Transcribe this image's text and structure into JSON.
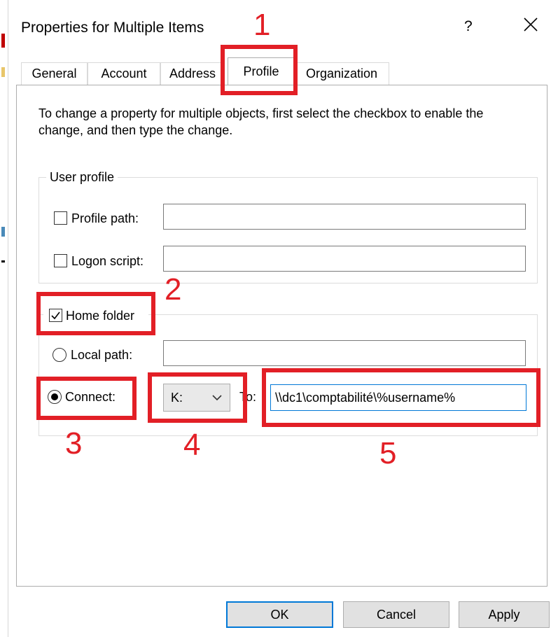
{
  "window": {
    "title": "Properties for Multiple Items",
    "help_label": "?",
    "close_icon": "close-icon"
  },
  "tabs": [
    {
      "label": "General",
      "active": false
    },
    {
      "label": "Account",
      "active": false
    },
    {
      "label": "Address",
      "active": false
    },
    {
      "label": "Profile",
      "active": true
    },
    {
      "label": "Organization",
      "active": false
    }
  ],
  "instruction": "To change a property for multiple objects, first select the checkbox to enable the change, and then type the change.",
  "user_profile": {
    "legend": "User profile",
    "profile_path": {
      "label": "Profile path:",
      "checked": false,
      "value": ""
    },
    "logon_script": {
      "label": "Logon script:",
      "checked": false,
      "value": ""
    }
  },
  "home_folder": {
    "legend": "Home folder",
    "checked": true,
    "local_path": {
      "label": "Local path:",
      "selected": false,
      "value": ""
    },
    "connect": {
      "label": "Connect:",
      "selected": true
    },
    "drive": {
      "value": "K:",
      "icon": "chevron-down-icon"
    },
    "to_label": "To:",
    "to_value": "\\\\dc1\\comptabilité\\%username%"
  },
  "buttons": {
    "ok": "OK",
    "cancel": "Cancel",
    "apply": "Apply"
  },
  "annotations": {
    "n1": "1",
    "n2": "2",
    "n3": "3",
    "n4": "4",
    "n5": "5"
  },
  "colors": {
    "annotation": "#e21f26",
    "focus": "#0078d7"
  }
}
